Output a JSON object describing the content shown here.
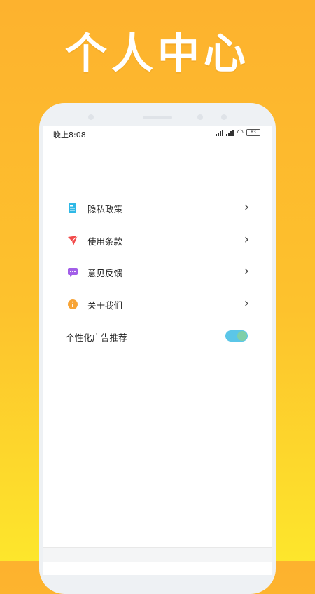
{
  "hero": {
    "title": "个人中心"
  },
  "status": {
    "time": "晚上8:08",
    "battery": "83"
  },
  "menu": {
    "items": [
      {
        "label": "隐私政策",
        "icon": "privacy-document-icon"
      },
      {
        "label": "使用条款",
        "icon": "terms-send-icon"
      },
      {
        "label": "意见反馈",
        "icon": "feedback-chat-icon"
      },
      {
        "label": "关于我们",
        "icon": "about-info-icon"
      }
    ]
  },
  "ad_personalization": {
    "label": "个性化广告推荐",
    "enabled": true
  },
  "colors": {
    "bg_top": "#fdb22e",
    "bg_bottom": "#fde62c",
    "toggle_track": "#5bc6e8",
    "toggle_knob": "#7fcfa8"
  }
}
